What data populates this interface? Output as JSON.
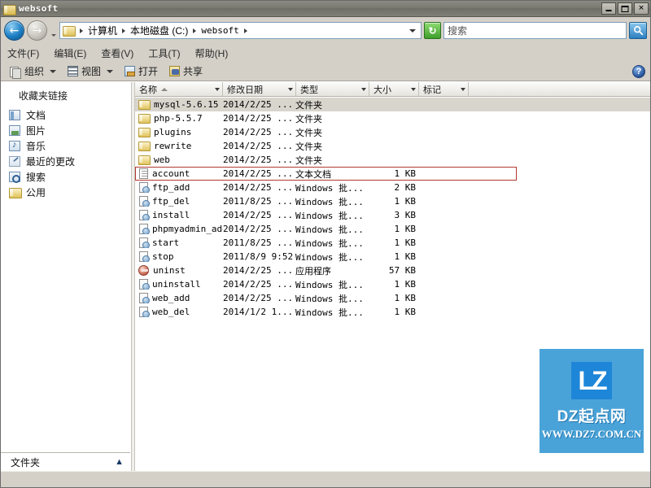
{
  "window": {
    "title": "websoft",
    "icon": "folder-icon",
    "buttons": {
      "minimize": "minimize-icon",
      "maximize": "maximize-icon",
      "close": "✕"
    }
  },
  "navigation": {
    "back": "←",
    "forward": "→",
    "history_dropdown": "chevron-down-icon",
    "address_dropdown": "chevron-down-icon",
    "refresh": "↻",
    "breadcrumbs": [
      {
        "label": "计算机"
      },
      {
        "label": "本地磁盘 (C:)"
      },
      {
        "label": "websoft"
      }
    ]
  },
  "search": {
    "placeholder": "搜索",
    "value": "",
    "button_icon": "search-icon"
  },
  "menubar": [
    {
      "label": "文件(F)"
    },
    {
      "label": "编辑(E)"
    },
    {
      "label": "查看(V)"
    },
    {
      "label": "工具(T)"
    },
    {
      "label": "帮助(H)"
    }
  ],
  "toolbar": {
    "organize_label": "组织",
    "view_label": "视图",
    "open_label": "打开",
    "share_label": "共享",
    "help_label": "?"
  },
  "sidebar": {
    "header": "收藏夹链接",
    "items": [
      {
        "label": "文档",
        "icon": "documents-icon"
      },
      {
        "label": "图片",
        "icon": "pictures-icon"
      },
      {
        "label": "音乐",
        "icon": "music-icon"
      },
      {
        "label": "最近的更改",
        "icon": "recent-changes-icon"
      },
      {
        "label": "搜索",
        "icon": "search-icon"
      },
      {
        "label": "公用",
        "icon": "public-folder-icon"
      }
    ],
    "folders_pane": {
      "label": "文件夹",
      "caret": "▲"
    }
  },
  "columns": [
    {
      "label": "名称",
      "sorted": "asc"
    },
    {
      "label": "修改日期",
      "sorted": ""
    },
    {
      "label": "类型",
      "sorted": ""
    },
    {
      "label": "大小",
      "sorted": ""
    },
    {
      "label": "标记",
      "sorted": ""
    }
  ],
  "files": [
    {
      "name": "mysql-5.6.15",
      "date": "2014/2/25 ...",
      "type": "文件夹",
      "size": "",
      "tag": "",
      "icon": "folder-icon",
      "selected": true,
      "highlighted": false
    },
    {
      "name": "php-5.5.7",
      "date": "2014/2/25 ...",
      "type": "文件夹",
      "size": "",
      "tag": "",
      "icon": "folder-icon",
      "selected": false,
      "highlighted": false
    },
    {
      "name": "plugins",
      "date": "2014/2/25 ...",
      "type": "文件夹",
      "size": "",
      "tag": "",
      "icon": "folder-icon",
      "selected": false,
      "highlighted": false
    },
    {
      "name": "rewrite",
      "date": "2014/2/25 ...",
      "type": "文件夹",
      "size": "",
      "tag": "",
      "icon": "folder-icon",
      "selected": false,
      "highlighted": false
    },
    {
      "name": "web",
      "date": "2014/2/25 ...",
      "type": "文件夹",
      "size": "",
      "tag": "",
      "icon": "folder-icon",
      "selected": false,
      "highlighted": false
    },
    {
      "name": "account",
      "date": "2014/2/25 ...",
      "type": "文本文档",
      "size": "1 KB",
      "tag": "",
      "icon": "text-file-icon",
      "selected": false,
      "highlighted": true
    },
    {
      "name": "ftp_add",
      "date": "2014/2/25 ...",
      "type": "Windows 批...",
      "size": "2 KB",
      "tag": "",
      "icon": "batch-file-icon",
      "selected": false,
      "highlighted": false
    },
    {
      "name": "ftp_del",
      "date": "2011/8/25 ...",
      "type": "Windows 批...",
      "size": "1 KB",
      "tag": "",
      "icon": "batch-file-icon",
      "selected": false,
      "highlighted": false
    },
    {
      "name": "install",
      "date": "2014/2/25 ...",
      "type": "Windows 批...",
      "size": "3 KB",
      "tag": "",
      "icon": "batch-file-icon",
      "selected": false,
      "highlighted": false
    },
    {
      "name": "phpmyadmin_add",
      "date": "2014/2/25 ...",
      "type": "Windows 批...",
      "size": "1 KB",
      "tag": "",
      "icon": "batch-file-icon",
      "selected": false,
      "highlighted": false
    },
    {
      "name": "start",
      "date": "2011/8/25 ...",
      "type": "Windows 批...",
      "size": "1 KB",
      "tag": "",
      "icon": "batch-file-icon",
      "selected": false,
      "highlighted": false
    },
    {
      "name": "stop",
      "date": "2011/8/9 9:52",
      "type": "Windows 批...",
      "size": "1 KB",
      "tag": "",
      "icon": "batch-file-icon",
      "selected": false,
      "highlighted": false
    },
    {
      "name": "uninst",
      "date": "2014/2/25 ...",
      "type": "应用程序",
      "size": "57 KB",
      "tag": "",
      "icon": "executable-icon",
      "selected": false,
      "highlighted": false
    },
    {
      "name": "uninstall",
      "date": "2014/2/25 ...",
      "type": "Windows 批...",
      "size": "1 KB",
      "tag": "",
      "icon": "batch-file-icon",
      "selected": false,
      "highlighted": false
    },
    {
      "name": "web_add",
      "date": "2014/2/25 ...",
      "type": "Windows 批...",
      "size": "1 KB",
      "tag": "",
      "icon": "batch-file-icon",
      "selected": false,
      "highlighted": false
    },
    {
      "name": "web_del",
      "date": "2014/1/2 1...",
      "type": "Windows 批...",
      "size": "1 KB",
      "tag": "",
      "icon": "batch-file-icon",
      "selected": false,
      "highlighted": false
    }
  ],
  "watermark": {
    "logo_text": "LZ",
    "title": "DZ起点网",
    "url": "WWW.DZ7.COM.CN",
    "bg_color": "#4aa3d8",
    "logo_color": "#1e86d8"
  },
  "colors": {
    "window_chrome": "#d4d0c8",
    "titlebar": "#7a7a72",
    "highlight_red": "#b03a32",
    "selection_grey": "#d8d5cd"
  }
}
